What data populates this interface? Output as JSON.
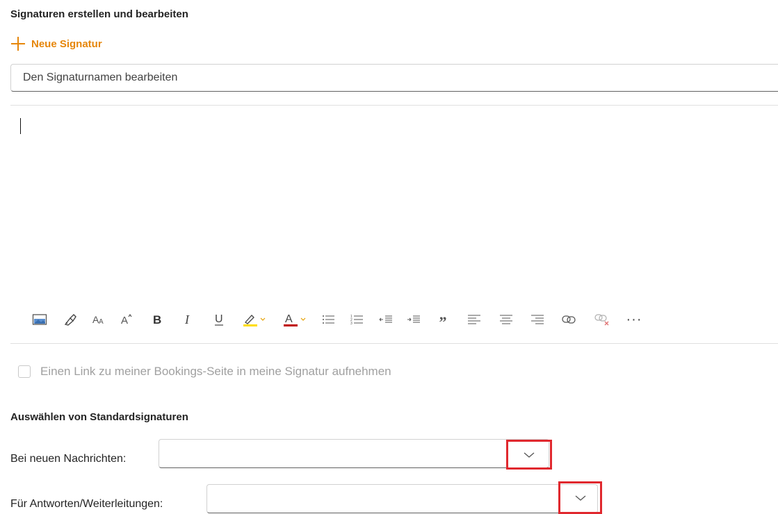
{
  "signatures": {
    "title": "Signaturen erstellen und bearbeiten",
    "new_label": "Neue Signatur",
    "name_placeholder": "Den Signaturnamen bearbeiten"
  },
  "toolbar": {
    "quote_glyph": "”",
    "more_glyph": "···",
    "highlight_color": "#ffdd00",
    "font_color": "#c00000"
  },
  "bookings": {
    "label": "Einen Link zu meiner Bookings-Seite in meine Signatur aufnehmen"
  },
  "defaults": {
    "title": "Auswählen von Standardsignaturen",
    "new_messages_label": "Bei neuen Nachrichten:",
    "new_messages_value": "",
    "replies_label": "Für Antworten/Weiterleitungen:",
    "replies_value": ""
  },
  "colors": {
    "accent": "#e6860a",
    "highlight_box": "#e0282e"
  }
}
